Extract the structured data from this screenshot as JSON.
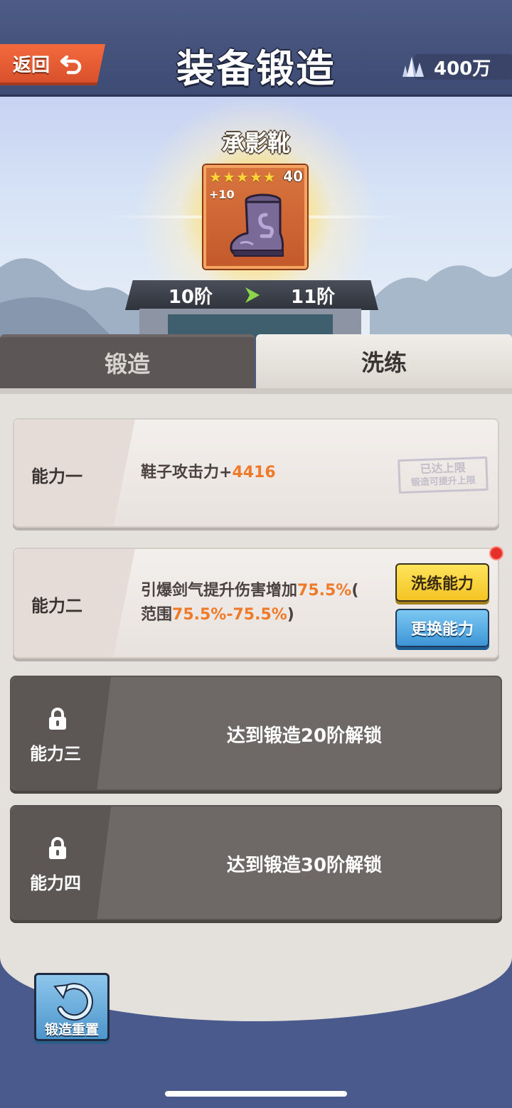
{
  "header": {
    "back_label": "返回",
    "title": "装备锻造",
    "currency_value": "400万",
    "currency_icon": "crystal-icon"
  },
  "item": {
    "name": "承影靴",
    "stars": 5,
    "level": "40",
    "plus": "+10",
    "icon": "boot-icon"
  },
  "rank": {
    "from": "10阶",
    "to": "11阶"
  },
  "tabs": [
    {
      "label": "锻造",
      "active": false
    },
    {
      "label": "洗练",
      "active": true
    }
  ],
  "abilities": [
    {
      "label": "能力一",
      "text_prefix": "鞋子攻击力+",
      "text_value": "4416",
      "stamp_line1": "已达上限",
      "stamp_line2": "锻造可提升上限"
    },
    {
      "label": "能力二",
      "line1_prefix": "引爆剑气提升伤害增加",
      "line1_value": "75.5%",
      "line1_suffix": "(",
      "line2_prefix": "范围",
      "line2_value": "75.5%-75.5%",
      "line2_suffix": ")",
      "refine_button": "洗练能力",
      "change_button": "更换能力"
    },
    {
      "label": "能力三",
      "locked_text": "达到锻造20阶解锁"
    },
    {
      "label": "能力四",
      "locked_text": "达到锻造30阶解锁"
    }
  ],
  "reset_button": "锻造重置",
  "colors": {
    "accent_orange": "#ef7a2a",
    "back_button": "#e85c32",
    "refine_button": "#f7d23a",
    "change_button": "#4ea2de",
    "notification": "#e62f2a"
  }
}
